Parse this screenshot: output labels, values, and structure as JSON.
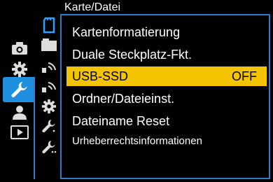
{
  "header": {
    "title": "Karte/Datei"
  },
  "categories": [
    {
      "name": "camera-icon"
    },
    {
      "name": "gear-icon"
    },
    {
      "name": "wrench-icon",
      "active": true
    },
    {
      "name": "person-icon"
    },
    {
      "name": "play-icon"
    }
  ],
  "tabs": [
    {
      "name": "card-tab-icon"
    },
    {
      "name": "monitor-tab-icon"
    },
    {
      "name": "wireless-tab-icon"
    },
    {
      "name": "wireless2-tab-icon"
    },
    {
      "name": "gear-tab-icon"
    },
    {
      "name": "wrench-tab-icon"
    },
    {
      "name": "wrench2-tab-icon"
    }
  ],
  "menu": {
    "items": [
      {
        "label": "Kartenformatierung",
        "value": ""
      },
      {
        "label": "Duale Steckplatz-Fkt.",
        "value": ""
      },
      {
        "label": "USB-SSD",
        "value": "OFF"
      },
      {
        "label": "Ordner/Dateieinst.",
        "value": ""
      },
      {
        "label": "Dateiname Reset",
        "value": ""
      },
      {
        "label": "Urheberrechtsinformationen",
        "value": ""
      }
    ],
    "selected_index": 2
  },
  "colors": {
    "accent_blue": "#1f8fe0",
    "selection_yellow": "#f5c400",
    "frame_blue": "#2b7cc9"
  }
}
